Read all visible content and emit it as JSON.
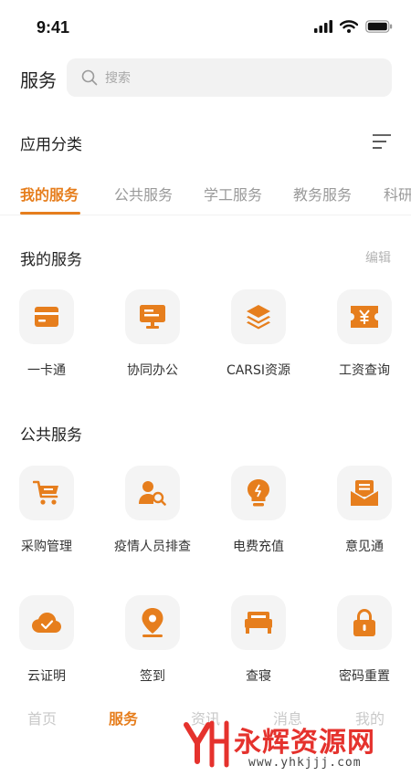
{
  "status_bar": {
    "time": "9:41"
  },
  "header": {
    "title": "服务",
    "search_placeholder": "搜索"
  },
  "category": {
    "title": "应用分类"
  },
  "tabs": [
    {
      "label": "我的服务",
      "active": true
    },
    {
      "label": "公共服务",
      "active": false
    },
    {
      "label": "学工服务",
      "active": false
    },
    {
      "label": "教务服务",
      "active": false
    },
    {
      "label": "科研",
      "active": false
    }
  ],
  "my_services": {
    "title": "我的服务",
    "edit_label": "编辑",
    "items": [
      {
        "label": "一卡通",
        "icon": "card-icon"
      },
      {
        "label": "协同办公",
        "icon": "monitor-icon"
      },
      {
        "label": "CARSI资源",
        "icon": "layers-icon"
      },
      {
        "label": "工资查询",
        "icon": "yuan-ticket-icon"
      }
    ]
  },
  "public_services": {
    "title": "公共服务",
    "items": [
      {
        "label": "采购管理",
        "icon": "cart-icon"
      },
      {
        "label": "疫情人员排查",
        "icon": "person-search-icon"
      },
      {
        "label": "电费充值",
        "icon": "lightbulb-icon"
      },
      {
        "label": "意见通",
        "icon": "mail-icon"
      },
      {
        "label": "云证明",
        "icon": "cloud-check-icon"
      },
      {
        "label": "签到",
        "icon": "location-pin-icon"
      },
      {
        "label": "查寝",
        "icon": "bed-icon"
      },
      {
        "label": "密码重置",
        "icon": "lock-icon"
      }
    ]
  },
  "tabbar": [
    {
      "label": "首页",
      "active": false
    },
    {
      "label": "服务",
      "active": true
    },
    {
      "label": "资讯",
      "active": false
    },
    {
      "label": "消息",
      "active": false
    },
    {
      "label": "我的",
      "active": false
    }
  ],
  "watermark": {
    "text": "永辉资源网",
    "url": "www.yhkjjj.com"
  },
  "colors": {
    "accent": "#e67e1d",
    "tile_bg": "#f4f4f4",
    "watermark_red": "#e5322d"
  }
}
